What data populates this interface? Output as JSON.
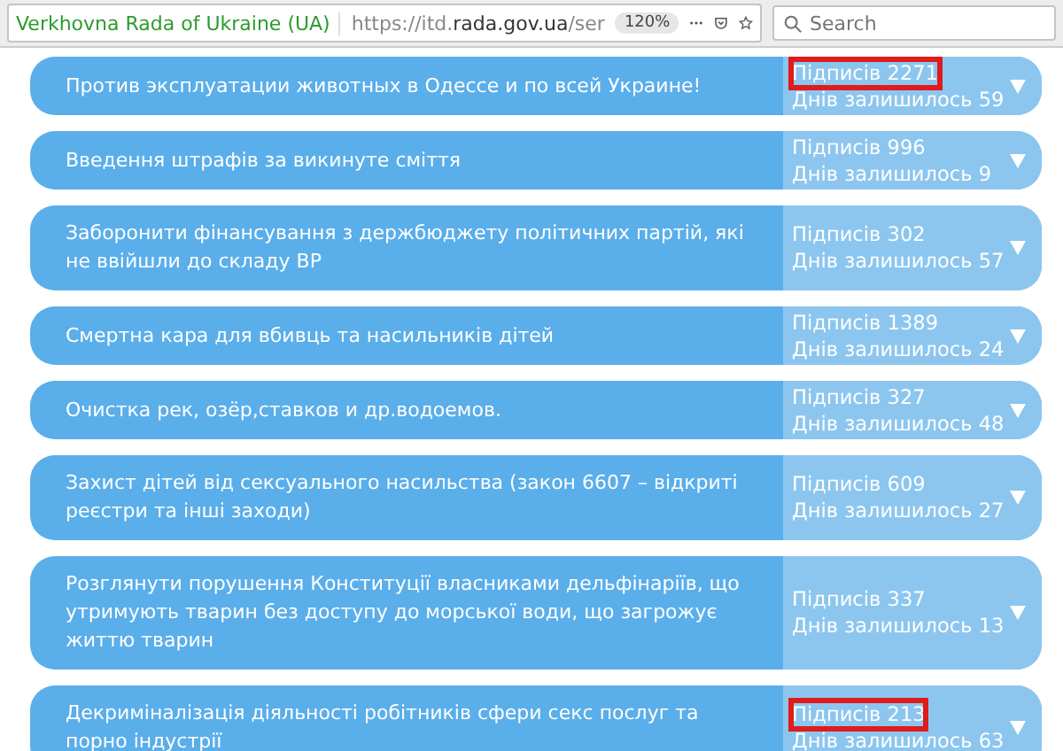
{
  "toolbar": {
    "site_identity": "Verkhovna Rada of Ukraine (UA)",
    "url_start": "https://itd.",
    "url_domain": "rada.gov.ua",
    "url_rest": "/ser",
    "zoom": "120%",
    "search": {
      "placeholder": "Search"
    }
  },
  "petitions": [
    {
      "title": "Против эксплуатации животных в Одессе и по всей Украине!",
      "signatures": "Підписів 2271",
      "days_left": "Днів залишилось 59",
      "highlighted": true
    },
    {
      "title": "Введення штрафів за викинуте сміття",
      "signatures": "Підписів 996",
      "days_left": "Днів залишилось 9",
      "highlighted": false
    },
    {
      "title": "Заборонити фінансування з держбюджету політичних партій, які не ввійшли до складу ВР",
      "signatures": "Підписів 302",
      "days_left": "Днів залишилось 57",
      "highlighted": false
    },
    {
      "title": "Смертна кара для вбивць та насильників дітей",
      "signatures": "Підписів 1389",
      "days_left": "Днів залишилось 24",
      "highlighted": false
    },
    {
      "title": "Очистка рек, озёр,ставков и др.водоемов.",
      "signatures": "Підписів 327",
      "days_left": "Днів залишилось 48",
      "highlighted": false
    },
    {
      "title": "Захист дітей від сексуального насильства (закон 6607 – відкриті реєстри та інші заходи)",
      "signatures": "Підписів 609",
      "days_left": "Днів залишилось 27",
      "highlighted": false
    },
    {
      "title": "Розглянути порушення Конституції власниками дельфінаріїв, що утримують тварин без доступу до морської води, що загрожує життю тварин",
      "signatures": "Підписів 337",
      "days_left": "Днів залишилось 13",
      "highlighted": false
    },
    {
      "title": "Декриміналізація діяльності робітників сфери секс послуг та порно індустрії",
      "signatures": "Підписів 213",
      "days_left": "Днів залишилось 63",
      "highlighted": true
    }
  ]
}
